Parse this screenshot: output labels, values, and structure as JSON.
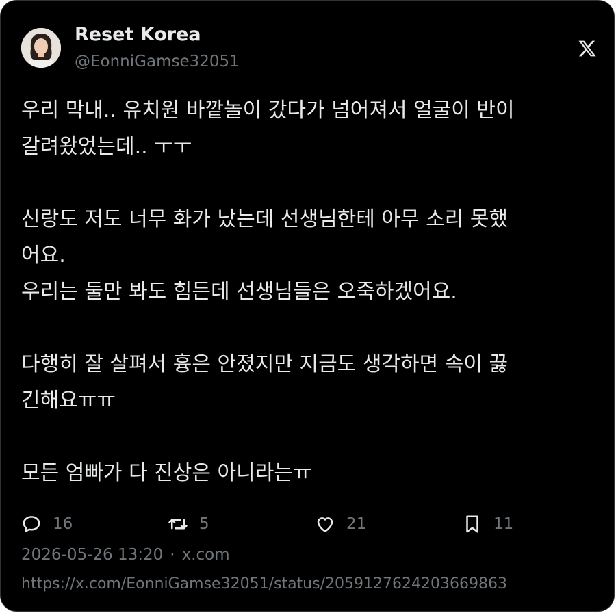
{
  "author": {
    "display_name": "Reset Korea",
    "handle": "@EonniGamse32051"
  },
  "post": {
    "text": "우리 막내.. 유치원 바깥놀이 갔다가 넘어져서 얼굴이 반이\n갈려왔었는데.. ㅜㅜ\n\n신랑도 저도 너무 화가 났는데 선생님한테 아무 소리 못했\n어요.\n우리는 둘만 봐도 힘든데 선생님들은 오죽하겠어요.\n\n다행히 잘 살펴서 흉은 안졌지만 지금도 생각하면 속이 끓\n긴해요ㅠㅠ\n\n모든 엄빠가 다 진상은 아니라는ㅠ"
  },
  "actions": {
    "replies": "16",
    "reposts": "5",
    "likes": "21",
    "bookmarks": "11"
  },
  "meta": {
    "timestamp": "2026-05-26 13:20",
    "separator": "·",
    "source": "x.com",
    "url": "https://x.com/EonniGamse32051/status/2059127624203669863"
  },
  "icons": {
    "brand": "x-logo-icon",
    "reply": "reply-bubble-icon",
    "repost": "repost-arrows-icon",
    "like": "heart-icon",
    "bookmark": "bookmark-icon"
  },
  "colors": {
    "background": "#000000",
    "primary_text": "#e7e9ea",
    "secondary_text": "#71767b",
    "border": "#2f3336"
  }
}
